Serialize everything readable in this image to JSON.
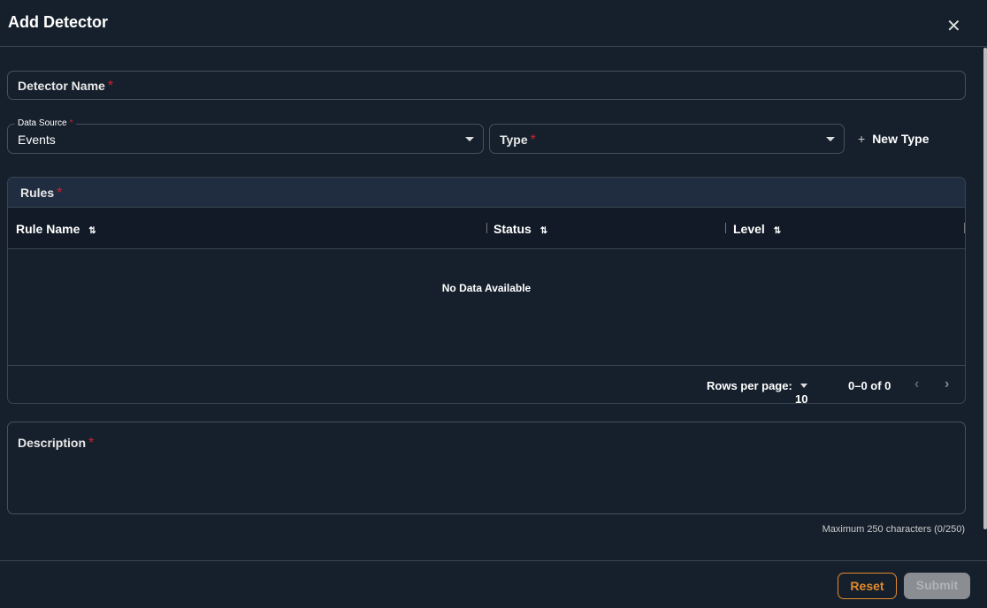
{
  "dialog": {
    "title": "Add Detector"
  },
  "form": {
    "detector_name_label": "Detector Name",
    "required_mark": "*",
    "data_source_label": "Data Source",
    "data_source_value": "Events",
    "type_label": "Type",
    "new_type_label": "New Type"
  },
  "rules": {
    "title": "Rules",
    "columns": [
      "Rule Name",
      "Status",
      "Level"
    ],
    "sort_glyph": "⇅",
    "empty_text": "No Data Available",
    "rows_per_page_label": "Rows per page:",
    "rows_per_page_value": "10",
    "range_text": "0–0 of 0"
  },
  "description": {
    "label": "Description",
    "helper": "Maximum 250 characters (0/250)"
  },
  "buttons": {
    "reset": "Reset",
    "submit": "Submit"
  },
  "colors": {
    "accent": "#e38a2a",
    "required": "#d0202a"
  }
}
